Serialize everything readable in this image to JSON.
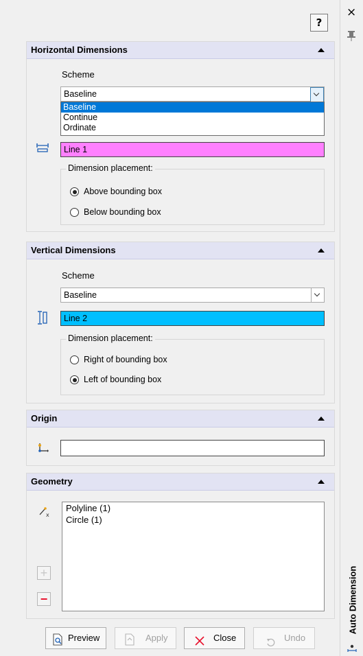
{
  "help_label": "?",
  "horizontal": {
    "title": "Horizontal Dimensions",
    "scheme_label": "Scheme",
    "scheme_value": "Baseline",
    "scheme_options": [
      "Baseline",
      "Continue",
      "Ordinate"
    ],
    "line_value": "Line 1",
    "line_color": "#ff80ff",
    "placement_title": "Dimension placement:",
    "opt_above": "Above bounding box",
    "opt_below": "Below bounding box"
  },
  "vertical": {
    "title": "Vertical Dimensions",
    "scheme_label": "Scheme",
    "scheme_value": "Baseline",
    "line_value": "Line 2",
    "line_color": "#00bfff",
    "placement_title": "Dimension placement:",
    "opt_right": "Right of bounding box",
    "opt_left": "Left of bounding box"
  },
  "origin": {
    "title": "Origin",
    "value": ""
  },
  "geometry": {
    "title": "Geometry",
    "items": [
      "Polyline (1)",
      "Circle (1)"
    ],
    "add_label": "+",
    "remove_label": "−"
  },
  "buttons": {
    "preview": "Preview",
    "apply": "Apply",
    "close": "Close",
    "undo": "Undo"
  },
  "dock": {
    "tab_label": "Auto Dimension",
    "close_label": "×"
  },
  "colors": {
    "header_bg": "#e2e3f3",
    "remove_red": "#e8112d",
    "close_x_red": "#e8112d",
    "selection_blue": "#0078d7"
  }
}
